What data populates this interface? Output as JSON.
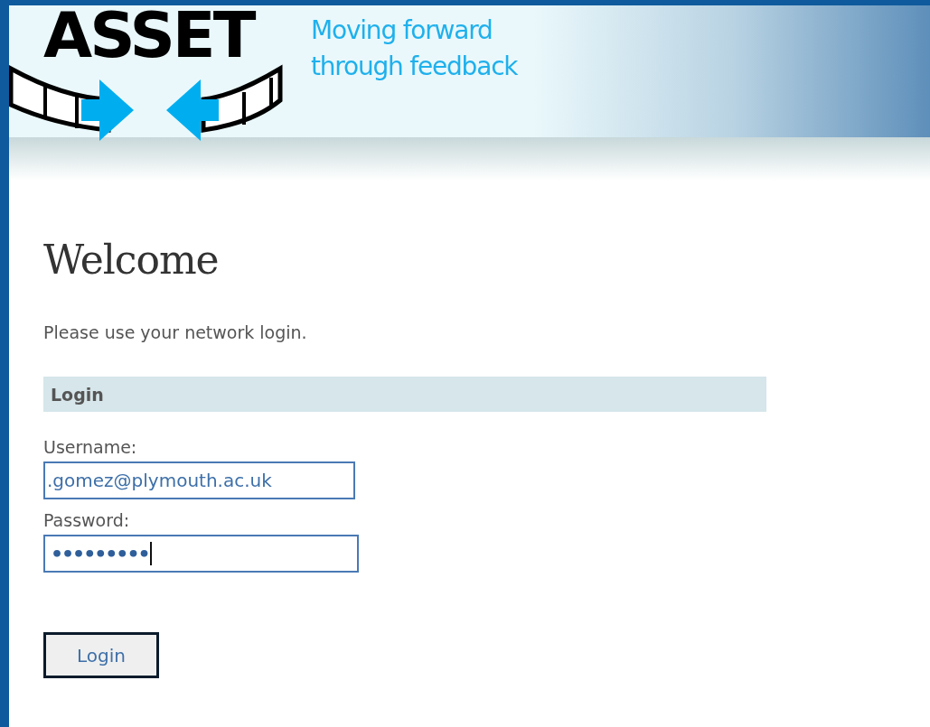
{
  "header": {
    "logo": "ASSET",
    "tagline": [
      "Moving forward",
      "through feedback"
    ]
  },
  "heading": "Welcome",
  "intro": "Please use your network login.",
  "section": "Login",
  "fields": [
    {
      "kind": "text",
      "label": "Username:",
      "value": ".gomez@plymouth.ac.uk",
      "focused": false
    },
    {
      "kind": "password",
      "label": "Password:",
      "value": "•••••••••",
      "focused": true
    }
  ],
  "button": "Login"
}
